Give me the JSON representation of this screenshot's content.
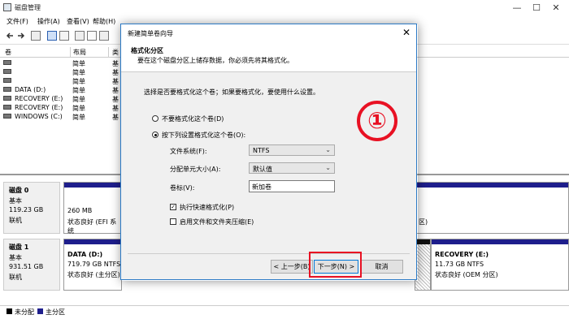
{
  "window": {
    "title": "磁盘管理",
    "minimize": "—",
    "maximize": "☐",
    "close": "✕"
  },
  "menu": [
    "文件(F)",
    "操作(A)",
    "查看(V)",
    "帮助(H)"
  ],
  "volume_list": {
    "columns": [
      "卷",
      "布局",
      "类"
    ],
    "rows": [
      {
        "name": "",
        "layout": "简单",
        "type": "基"
      },
      {
        "name": "",
        "layout": "简单",
        "type": "基"
      },
      {
        "name": "",
        "layout": "简单",
        "type": "基"
      },
      {
        "name": "DATA (D:)",
        "layout": "简单",
        "type": "基"
      },
      {
        "name": "RECOVERY (E:)",
        "layout": "简单",
        "type": "基"
      },
      {
        "name": "RECOVERY (E:)",
        "layout": "简单",
        "type": "基"
      },
      {
        "name": "WINDOWS (C:)",
        "layout": "简单",
        "type": "基"
      }
    ]
  },
  "disks": [
    {
      "name": "磁盘 0",
      "kind": "基本",
      "size": "119.23 GB",
      "status": "联机",
      "part1": {
        "size": "260 MB",
        "status": "状态良好 (EFI 系统"
      },
      "right_part_status": "区)"
    },
    {
      "name": "磁盘 1",
      "kind": "基本",
      "size": "931.51 GB",
      "status": "联机",
      "part1": {
        "name": "DATA  (D:)",
        "size": "719.79 GB NTFS",
        "status": "状态良好 (主分区)"
      },
      "part_last": {
        "name": "RECOVERY  (E:)",
        "size": "11.73 GB NTFS",
        "status": "状态良好 (OEM 分区)"
      }
    }
  ],
  "legend": {
    "unallocated": "未分配",
    "primary": "主分区"
  },
  "dialog": {
    "title": "新建简单卷向导",
    "close": "✕",
    "heading": "格式化分区",
    "subheading": "要在这个磁盘分区上储存数据，你必须先将其格式化。",
    "prompt": "选择是否要格式化这个卷；如果要格式化，要使用什么设置。",
    "opt_no_format": "不要格式化这个卷(D)",
    "opt_format": "按下列设置格式化这个卷(O):",
    "fs_label": "文件系统(F):",
    "fs_value": "NTFS",
    "unit_label": "分配单元大小(A):",
    "unit_value": "默认值",
    "vol_label": "卷标(V):",
    "vol_value": "新加卷",
    "quick_format": "执行快速格式化(P)",
    "compression": "启用文件和文件夹压缩(E)",
    "back": "< 上一步(B)",
    "next": "下一步(N) >",
    "cancel": "取消"
  },
  "annotation": {
    "step": "①"
  },
  "colors": {
    "primary_partition": "#1e1e8c",
    "highlight": "#e81123",
    "accent": "#0078d7"
  }
}
